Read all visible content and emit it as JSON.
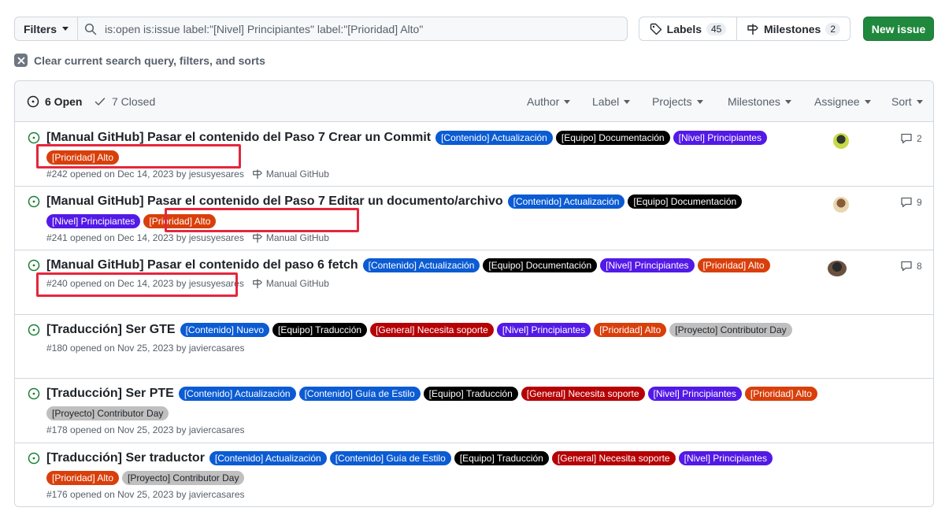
{
  "filters": {
    "label": "Filters"
  },
  "search": {
    "query": "is:open is:issue label:\"[Nivel] Principiantes\" label:\"[Prioridad] Alto\"",
    "icon": "search-icon"
  },
  "labels_btn": {
    "label": "Labels",
    "count": "45"
  },
  "milestones_btn": {
    "label": "Milestones",
    "count": "2"
  },
  "new_issue": {
    "label": "New issue"
  },
  "clear": {
    "label": "Clear current search query, filters, and sorts"
  },
  "header": {
    "open": "6 Open",
    "closed": "7 Closed",
    "filters": [
      "Author",
      "Label",
      "Projects",
      "Milestones",
      "Assignee",
      "Sort"
    ]
  },
  "colors": {
    "accent_green": "#1f883d",
    "contenido": "#0b5bd3",
    "equipo": "#000000",
    "general": "#b60205",
    "nivel": "#5319e7",
    "prioridad": "#d93f0b",
    "proyecto": "#bfbfbf",
    "highlight": "#e5263d"
  },
  "issues": [
    {
      "title": "[Manual GitHub] Pasar el contenido del Paso 7 Crear un Commit",
      "labels": [
        {
          "text": "[Contenido] Actualización",
          "kind": "contenido"
        },
        {
          "text": "[Equipo] Documentación",
          "kind": "equipo"
        },
        {
          "text": "[Nivel] Principiantes",
          "kind": "nivel"
        },
        {
          "text": "[Prioridad] Alto",
          "kind": "prioridad"
        }
      ],
      "meta": "#242 opened on Dec 14, 2023 by jesusyesares",
      "milestone": "Manual GitHub",
      "comments": "2",
      "assignee": true
    },
    {
      "title": "[Manual GitHub] Pasar el contenido del Paso 7 Editar un documento/archivo",
      "labels": [
        {
          "text": "[Contenido] Actualización",
          "kind": "contenido"
        },
        {
          "text": "[Equipo] Documentación",
          "kind": "equipo"
        },
        {
          "text": "[Nivel] Principiantes",
          "kind": "nivel"
        },
        {
          "text": "[Prioridad] Alto",
          "kind": "prioridad"
        }
      ],
      "meta": "#241 opened on Dec 14, 2023 by jesusyesares",
      "milestone": "Manual GitHub",
      "comments": "9",
      "assignee": true
    },
    {
      "title": "[Manual GitHub] Pasar el contenido del paso 6 fetch",
      "labels": [
        {
          "text": "[Contenido] Actualización",
          "kind": "contenido"
        },
        {
          "text": "[Equipo] Documentación",
          "kind": "equipo"
        },
        {
          "text": "[Nivel] Principiantes",
          "kind": "nivel"
        },
        {
          "text": "[Prioridad] Alto",
          "kind": "prioridad"
        }
      ],
      "meta": "#240 opened on Dec 14, 2023 by jesusyesares",
      "milestone": "Manual GitHub",
      "comments": "8",
      "assignee": true
    },
    {
      "title": "[Traducción] Ser GTE",
      "labels": [
        {
          "text": "[Contenido] Nuevo",
          "kind": "contenido"
        },
        {
          "text": "[Equipo] Traducción",
          "kind": "equipo"
        },
        {
          "text": "[General] Necesita soporte",
          "kind": "general"
        },
        {
          "text": "[Nivel] Principiantes",
          "kind": "nivel"
        },
        {
          "text": "[Prioridad] Alto",
          "kind": "prioridad"
        },
        {
          "text": "[Proyecto] Contributor Day",
          "kind": "proyecto"
        }
      ],
      "meta": "#180 opened on Nov 25, 2023 by javiercasares",
      "milestone": "",
      "comments": "",
      "assignee": false
    },
    {
      "title": "[Traducción] Ser PTE",
      "labels": [
        {
          "text": "[Contenido] Actualización",
          "kind": "contenido"
        },
        {
          "text": "[Contenido] Guía de Estilo",
          "kind": "contenido"
        },
        {
          "text": "[Equipo] Traducción",
          "kind": "equipo"
        },
        {
          "text": "[General] Necesita soporte",
          "kind": "general"
        },
        {
          "text": "[Nivel] Principiantes",
          "kind": "nivel"
        },
        {
          "text": "[Prioridad] Alto",
          "kind": "prioridad"
        },
        {
          "text": "[Proyecto] Contributor Day",
          "kind": "proyecto"
        }
      ],
      "meta": "#178 opened on Nov 25, 2023 by javiercasares",
      "milestone": "",
      "comments": "",
      "assignee": false
    },
    {
      "title": "[Traducción] Ser traductor",
      "labels": [
        {
          "text": "[Contenido] Actualización",
          "kind": "contenido"
        },
        {
          "text": "[Contenido] Guía de Estilo",
          "kind": "contenido"
        },
        {
          "text": "[Equipo] Traducción",
          "kind": "equipo"
        },
        {
          "text": "[General] Necesita soporte",
          "kind": "general"
        },
        {
          "text": "[Nivel] Principiantes",
          "kind": "nivel"
        },
        {
          "text": "[Prioridad] Alto",
          "kind": "prioridad"
        },
        {
          "text": "[Proyecto] Contributor Day",
          "kind": "proyecto"
        }
      ],
      "meta": "#176 opened on Nov 25, 2023 by javiercasares",
      "milestone": "",
      "comments": "",
      "assignee": false
    }
  ]
}
